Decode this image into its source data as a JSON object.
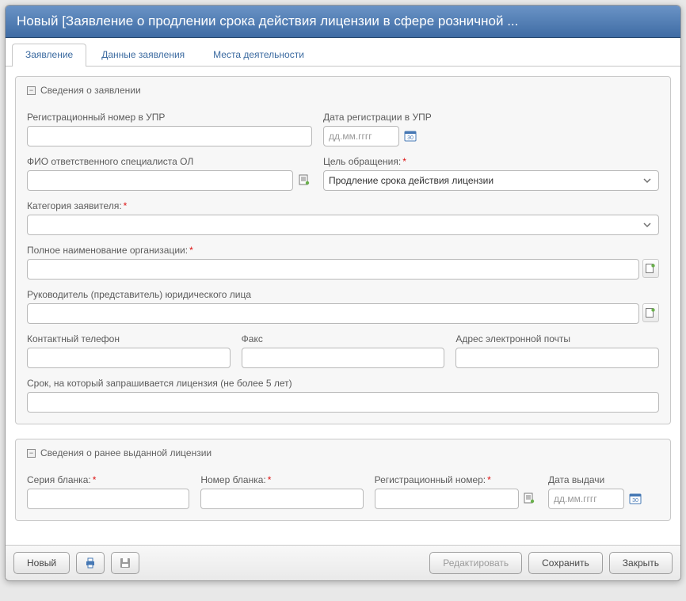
{
  "window": {
    "title": "Новый [Заявление о продлении срока действия лицензии в сфере розничной ..."
  },
  "tabs": [
    {
      "label": "Заявление",
      "active": true
    },
    {
      "label": "Данные заявления",
      "active": false
    },
    {
      "label": "Места деятельности",
      "active": false
    }
  ],
  "group_app": {
    "legend": "Сведения о заявлении",
    "reg_number_label": "Регистрационный номер в УПР",
    "reg_number_value": "",
    "reg_date_label": "Дата регистрации в УПР",
    "reg_date_placeholder": "дд.мм.гггг",
    "reg_date_value": "",
    "specialist_label": "ФИО ответственного специалиста ОЛ",
    "specialist_value": "",
    "purpose_label": "Цель обращения:",
    "purpose_value": "Продление срока действия лицензии",
    "category_label": "Категория заявителя:",
    "category_value": "",
    "org_label": "Полное наименование организации:",
    "org_value": "",
    "head_label": "Руководитель (представитель) юридического лица",
    "head_value": "",
    "phone_label": "Контактный телефон",
    "phone_value": "",
    "fax_label": "Факс",
    "fax_value": "",
    "email_label": "Адрес электронной почты",
    "email_value": "",
    "term_label": "Срок, на который запрашивается лицензия (не более 5 лет)",
    "term_value": ""
  },
  "group_prev": {
    "legend": "Сведения о ранее выданной лицензии",
    "series_label": "Серия бланка:",
    "series_value": "",
    "blank_number_label": "Номер бланка:",
    "blank_number_value": "",
    "reg_number_label": "Регистрационный номер:",
    "reg_number_value": "",
    "issue_date_label": "Дата выдачи",
    "issue_date_placeholder": "дд.мм.гггг",
    "issue_date_value": ""
  },
  "footer": {
    "new_label": "Новый",
    "edit_label": "Редактировать",
    "save_label": "Сохранить",
    "close_label": "Закрыть"
  },
  "icons": {
    "collapse": "−"
  }
}
